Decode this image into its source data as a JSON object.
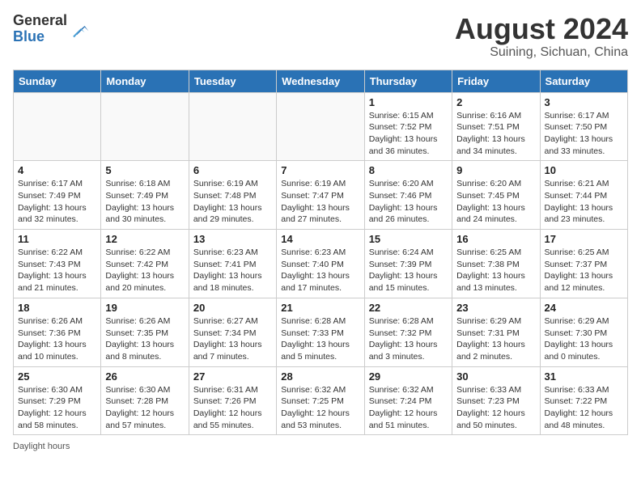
{
  "header": {
    "logo_general": "General",
    "logo_blue": "Blue",
    "month_year": "August 2024",
    "location": "Suining, Sichuan, China"
  },
  "days_of_week": [
    "Sunday",
    "Monday",
    "Tuesday",
    "Wednesday",
    "Thursday",
    "Friday",
    "Saturday"
  ],
  "weeks": [
    [
      {
        "day": "",
        "info": ""
      },
      {
        "day": "",
        "info": ""
      },
      {
        "day": "",
        "info": ""
      },
      {
        "day": "",
        "info": ""
      },
      {
        "day": "1",
        "info": "Sunrise: 6:15 AM\nSunset: 7:52 PM\nDaylight: 13 hours\nand 36 minutes."
      },
      {
        "day": "2",
        "info": "Sunrise: 6:16 AM\nSunset: 7:51 PM\nDaylight: 13 hours\nand 34 minutes."
      },
      {
        "day": "3",
        "info": "Sunrise: 6:17 AM\nSunset: 7:50 PM\nDaylight: 13 hours\nand 33 minutes."
      }
    ],
    [
      {
        "day": "4",
        "info": "Sunrise: 6:17 AM\nSunset: 7:49 PM\nDaylight: 13 hours\nand 32 minutes."
      },
      {
        "day": "5",
        "info": "Sunrise: 6:18 AM\nSunset: 7:49 PM\nDaylight: 13 hours\nand 30 minutes."
      },
      {
        "day": "6",
        "info": "Sunrise: 6:19 AM\nSunset: 7:48 PM\nDaylight: 13 hours\nand 29 minutes."
      },
      {
        "day": "7",
        "info": "Sunrise: 6:19 AM\nSunset: 7:47 PM\nDaylight: 13 hours\nand 27 minutes."
      },
      {
        "day": "8",
        "info": "Sunrise: 6:20 AM\nSunset: 7:46 PM\nDaylight: 13 hours\nand 26 minutes."
      },
      {
        "day": "9",
        "info": "Sunrise: 6:20 AM\nSunset: 7:45 PM\nDaylight: 13 hours\nand 24 minutes."
      },
      {
        "day": "10",
        "info": "Sunrise: 6:21 AM\nSunset: 7:44 PM\nDaylight: 13 hours\nand 23 minutes."
      }
    ],
    [
      {
        "day": "11",
        "info": "Sunrise: 6:22 AM\nSunset: 7:43 PM\nDaylight: 13 hours\nand 21 minutes."
      },
      {
        "day": "12",
        "info": "Sunrise: 6:22 AM\nSunset: 7:42 PM\nDaylight: 13 hours\nand 20 minutes."
      },
      {
        "day": "13",
        "info": "Sunrise: 6:23 AM\nSunset: 7:41 PM\nDaylight: 13 hours\nand 18 minutes."
      },
      {
        "day": "14",
        "info": "Sunrise: 6:23 AM\nSunset: 7:40 PM\nDaylight: 13 hours\nand 17 minutes."
      },
      {
        "day": "15",
        "info": "Sunrise: 6:24 AM\nSunset: 7:39 PM\nDaylight: 13 hours\nand 15 minutes."
      },
      {
        "day": "16",
        "info": "Sunrise: 6:25 AM\nSunset: 7:38 PM\nDaylight: 13 hours\nand 13 minutes."
      },
      {
        "day": "17",
        "info": "Sunrise: 6:25 AM\nSunset: 7:37 PM\nDaylight: 13 hours\nand 12 minutes."
      }
    ],
    [
      {
        "day": "18",
        "info": "Sunrise: 6:26 AM\nSunset: 7:36 PM\nDaylight: 13 hours\nand 10 minutes."
      },
      {
        "day": "19",
        "info": "Sunrise: 6:26 AM\nSunset: 7:35 PM\nDaylight: 13 hours\nand 8 minutes."
      },
      {
        "day": "20",
        "info": "Sunrise: 6:27 AM\nSunset: 7:34 PM\nDaylight: 13 hours\nand 7 minutes."
      },
      {
        "day": "21",
        "info": "Sunrise: 6:28 AM\nSunset: 7:33 PM\nDaylight: 13 hours\nand 5 minutes."
      },
      {
        "day": "22",
        "info": "Sunrise: 6:28 AM\nSunset: 7:32 PM\nDaylight: 13 hours\nand 3 minutes."
      },
      {
        "day": "23",
        "info": "Sunrise: 6:29 AM\nSunset: 7:31 PM\nDaylight: 13 hours\nand 2 minutes."
      },
      {
        "day": "24",
        "info": "Sunrise: 6:29 AM\nSunset: 7:30 PM\nDaylight: 13 hours\nand 0 minutes."
      }
    ],
    [
      {
        "day": "25",
        "info": "Sunrise: 6:30 AM\nSunset: 7:29 PM\nDaylight: 12 hours\nand 58 minutes."
      },
      {
        "day": "26",
        "info": "Sunrise: 6:30 AM\nSunset: 7:28 PM\nDaylight: 12 hours\nand 57 minutes."
      },
      {
        "day": "27",
        "info": "Sunrise: 6:31 AM\nSunset: 7:26 PM\nDaylight: 12 hours\nand 55 minutes."
      },
      {
        "day": "28",
        "info": "Sunrise: 6:32 AM\nSunset: 7:25 PM\nDaylight: 12 hours\nand 53 minutes."
      },
      {
        "day": "29",
        "info": "Sunrise: 6:32 AM\nSunset: 7:24 PM\nDaylight: 12 hours\nand 51 minutes."
      },
      {
        "day": "30",
        "info": "Sunrise: 6:33 AM\nSunset: 7:23 PM\nDaylight: 12 hours\nand 50 minutes."
      },
      {
        "day": "31",
        "info": "Sunrise: 6:33 AM\nSunset: 7:22 PM\nDaylight: 12 hours\nand 48 minutes."
      }
    ]
  ],
  "footer": {
    "note": "Daylight hours"
  }
}
